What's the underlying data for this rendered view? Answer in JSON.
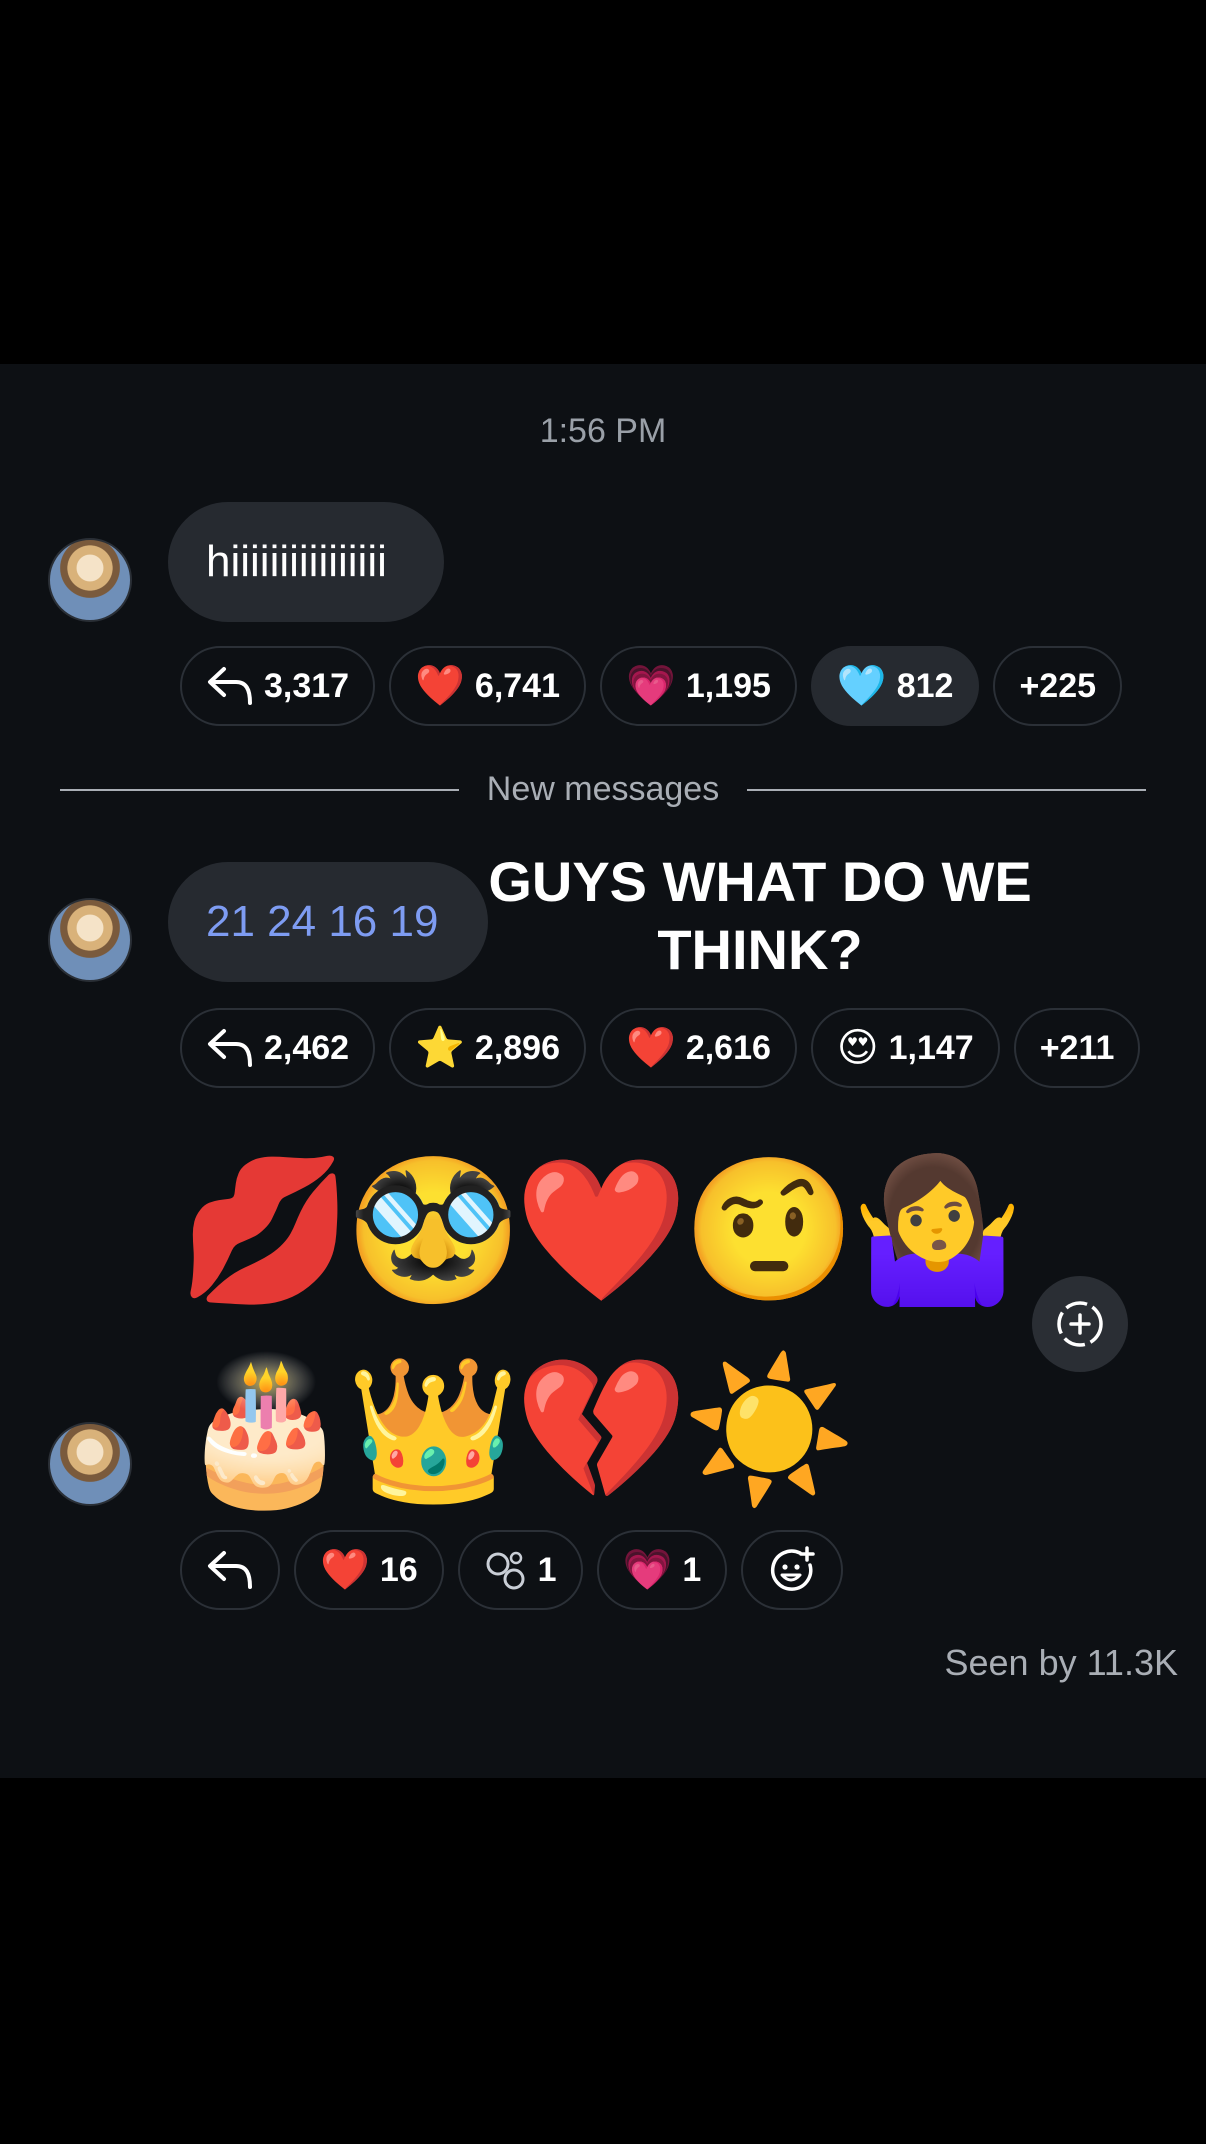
{
  "timestamp": "1:56 PM",
  "messages": [
    {
      "text": "hiiiiiiiiiiiiiiii",
      "reactions": [
        {
          "emoji": "reply-icon",
          "count": "3,317"
        },
        {
          "emoji": "❤️",
          "count": "6,741"
        },
        {
          "emoji": "💗",
          "count": "1,195"
        },
        {
          "emoji": "🩵",
          "count": "812"
        },
        {
          "emoji": "",
          "count": "+225"
        }
      ]
    },
    {
      "text": "21 24 16 19",
      "caption": "GUYS WHAT DO WE THINK?",
      "reactions": [
        {
          "emoji": "reply-icon",
          "count": "2,462"
        },
        {
          "emoji": "⭐",
          "count": "2,896"
        },
        {
          "emoji": "❤️",
          "count": "2,616"
        },
        {
          "emoji": "😍",
          "count": "1,147"
        },
        {
          "emoji": "",
          "count": "+211"
        }
      ]
    },
    {
      "emojis": [
        "💋",
        "🥸",
        "❤️",
        "🤨",
        "🤷‍♀️",
        "🎂",
        "👑",
        "💔",
        "☀️"
      ],
      "reactions": [
        {
          "emoji": "reply-icon",
          "count": ""
        },
        {
          "emoji": "❤️",
          "count": "16"
        },
        {
          "emoji": "bubbles-icon",
          "count": "1"
        },
        {
          "emoji": "💗",
          "count": "1"
        },
        {
          "emoji": "add-reaction-icon",
          "count": ""
        }
      ]
    }
  ],
  "divider_label": "New messages",
  "seen_label": "Seen by 11.3K",
  "colors": {
    "panel": "#0d1014",
    "bubble": "#262a30",
    "link": "#7e9cf2"
  }
}
